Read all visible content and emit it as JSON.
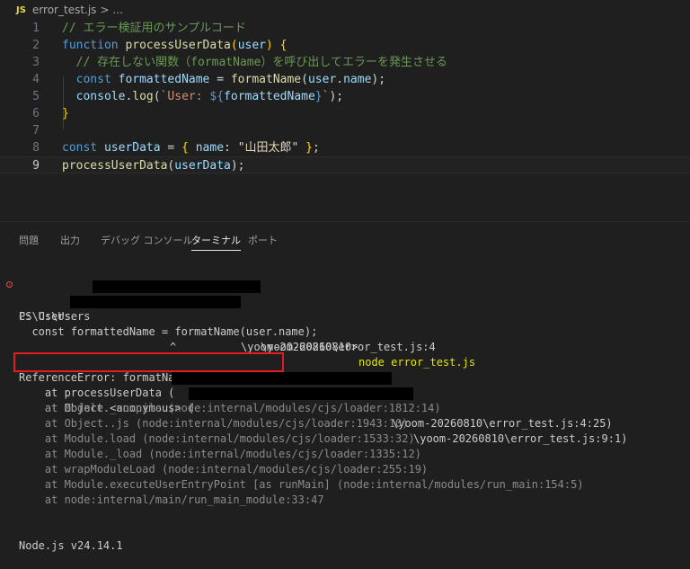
{
  "breadcrumb": {
    "file_badge": "JS",
    "file_name": "error_test.js",
    "separator": ">",
    "more": "..."
  },
  "editor": {
    "active_line": 9,
    "lines": [
      {
        "num": "1",
        "tokens": [
          {
            "t": "// エラー検証用のサンプルコード",
            "c": "c-com"
          }
        ]
      },
      {
        "num": "2",
        "tokens": [
          {
            "t": "function ",
            "c": "c-kw"
          },
          {
            "t": "processUserData",
            "c": "c-fn"
          },
          {
            "t": "(",
            "c": "c-brace"
          },
          {
            "t": "user",
            "c": "c-var"
          },
          {
            "t": ") ",
            "c": "c-brace"
          },
          {
            "t": "{",
            "c": "c-brace"
          }
        ]
      },
      {
        "num": "3",
        "tokens": [
          {
            "t": "  // 存在しない関数（formatName）を呼び出してエラーを発生させる",
            "c": "c-com"
          }
        ]
      },
      {
        "num": "4",
        "tokens": [
          {
            "t": "  const ",
            "c": "c-kw"
          },
          {
            "t": "formattedName",
            "c": "c-var"
          },
          {
            "t": " = ",
            "c": "c-punc"
          },
          {
            "t": "formatName",
            "c": "c-fn"
          },
          {
            "t": "(",
            "c": "c-punc"
          },
          {
            "t": "user",
            "c": "c-var"
          },
          {
            "t": ".",
            "c": "c-punc"
          },
          {
            "t": "name",
            "c": "c-var"
          },
          {
            "t": ");",
            "c": "c-punc"
          }
        ]
      },
      {
        "num": "5",
        "tokens": [
          {
            "t": "  console",
            "c": "c-var"
          },
          {
            "t": ".",
            "c": "c-punc"
          },
          {
            "t": "log",
            "c": "c-fn"
          },
          {
            "t": "(",
            "c": "c-punc"
          },
          {
            "t": "`User: ",
            "c": "c-str"
          },
          {
            "t": "${",
            "c": "c-kw"
          },
          {
            "t": "formattedName",
            "c": "c-var"
          },
          {
            "t": "}",
            "c": "c-kw"
          },
          {
            "t": "`",
            "c": "c-str"
          },
          {
            "t": ");",
            "c": "c-punc"
          }
        ]
      },
      {
        "num": "6",
        "tokens": [
          {
            "t": "}",
            "c": "c-brace"
          }
        ]
      },
      {
        "num": "7",
        "tokens": []
      },
      {
        "num": "8",
        "tokens": [
          {
            "t": "const ",
            "c": "c-kw"
          },
          {
            "t": "userData",
            "c": "c-var"
          },
          {
            "t": " = ",
            "c": "c-punc"
          },
          {
            "t": "{ ",
            "c": "c-brace"
          },
          {
            "t": "name",
            "c": "c-var"
          },
          {
            "t": ": ",
            "c": "c-punc"
          },
          {
            "t": "\"山田太郎\"",
            "c": "c-str-bright"
          },
          {
            "t": " }",
            "c": "c-brace"
          },
          {
            "t": ";",
            "c": "c-punc"
          }
        ]
      },
      {
        "num": "9",
        "tokens": [
          {
            "t": "processUserData",
            "c": "c-fn"
          },
          {
            "t": "(",
            "c": "c-punc"
          },
          {
            "t": "userData",
            "c": "c-var"
          },
          {
            "t": ");",
            "c": "c-punc"
          }
        ]
      }
    ]
  },
  "panel": {
    "tabs": [
      {
        "label": "問題"
      },
      {
        "label": "出力"
      },
      {
        "label": "デバッグ コンソール"
      },
      {
        "label": "ターミナル",
        "active": true
      },
      {
        "label": "ポート"
      }
    ]
  },
  "terminal": {
    "prompt_prefix": "PS C:\\Users",
    "prompt_path_tail": "\\yoom-20260810> ",
    "command": "node error_test.js",
    "loc_prefix": "C:\\Users",
    "loc_tail": "\\yoom-20260810\\error_test.js:4",
    "source_line": "  const formattedName = formatName(user.name);",
    "caret": "^",
    "error_message": "ReferenceError: formatName is not defined",
    "stack_bright": [
      {
        "head": "    at processUserData (",
        "tail": "\\yoom-20260810\\error_test.js:4:25)"
      },
      {
        "head": "    at Object.<anonymous> (",
        "tail": "\\yoom-20260810\\error_test.js:9:1)"
      }
    ],
    "stack_dim": [
      "    at Module._compile (node:internal/modules/cjs/loader:1812:14)",
      "    at Object..js (node:internal/modules/cjs/loader:1943:10)",
      "    at Module.load (node:internal/modules/cjs/loader:1533:32)",
      "    at Module._load (node:internal/modules/cjs/loader:1335:12)",
      "    at wrapModuleLoad (node:internal/modules/cjs/loader:255:19)",
      "    at Module.executeUserEntryPoint [as runMain] (node:internal/modules/run_main:154:5)",
      "    at node:internal/main/run_main_module:33:47"
    ],
    "node_version": "Node.js v24.14.1"
  },
  "colors": {
    "background": "#1f1f1f",
    "error_highlight": "#e11d21",
    "redaction": "#000000"
  }
}
